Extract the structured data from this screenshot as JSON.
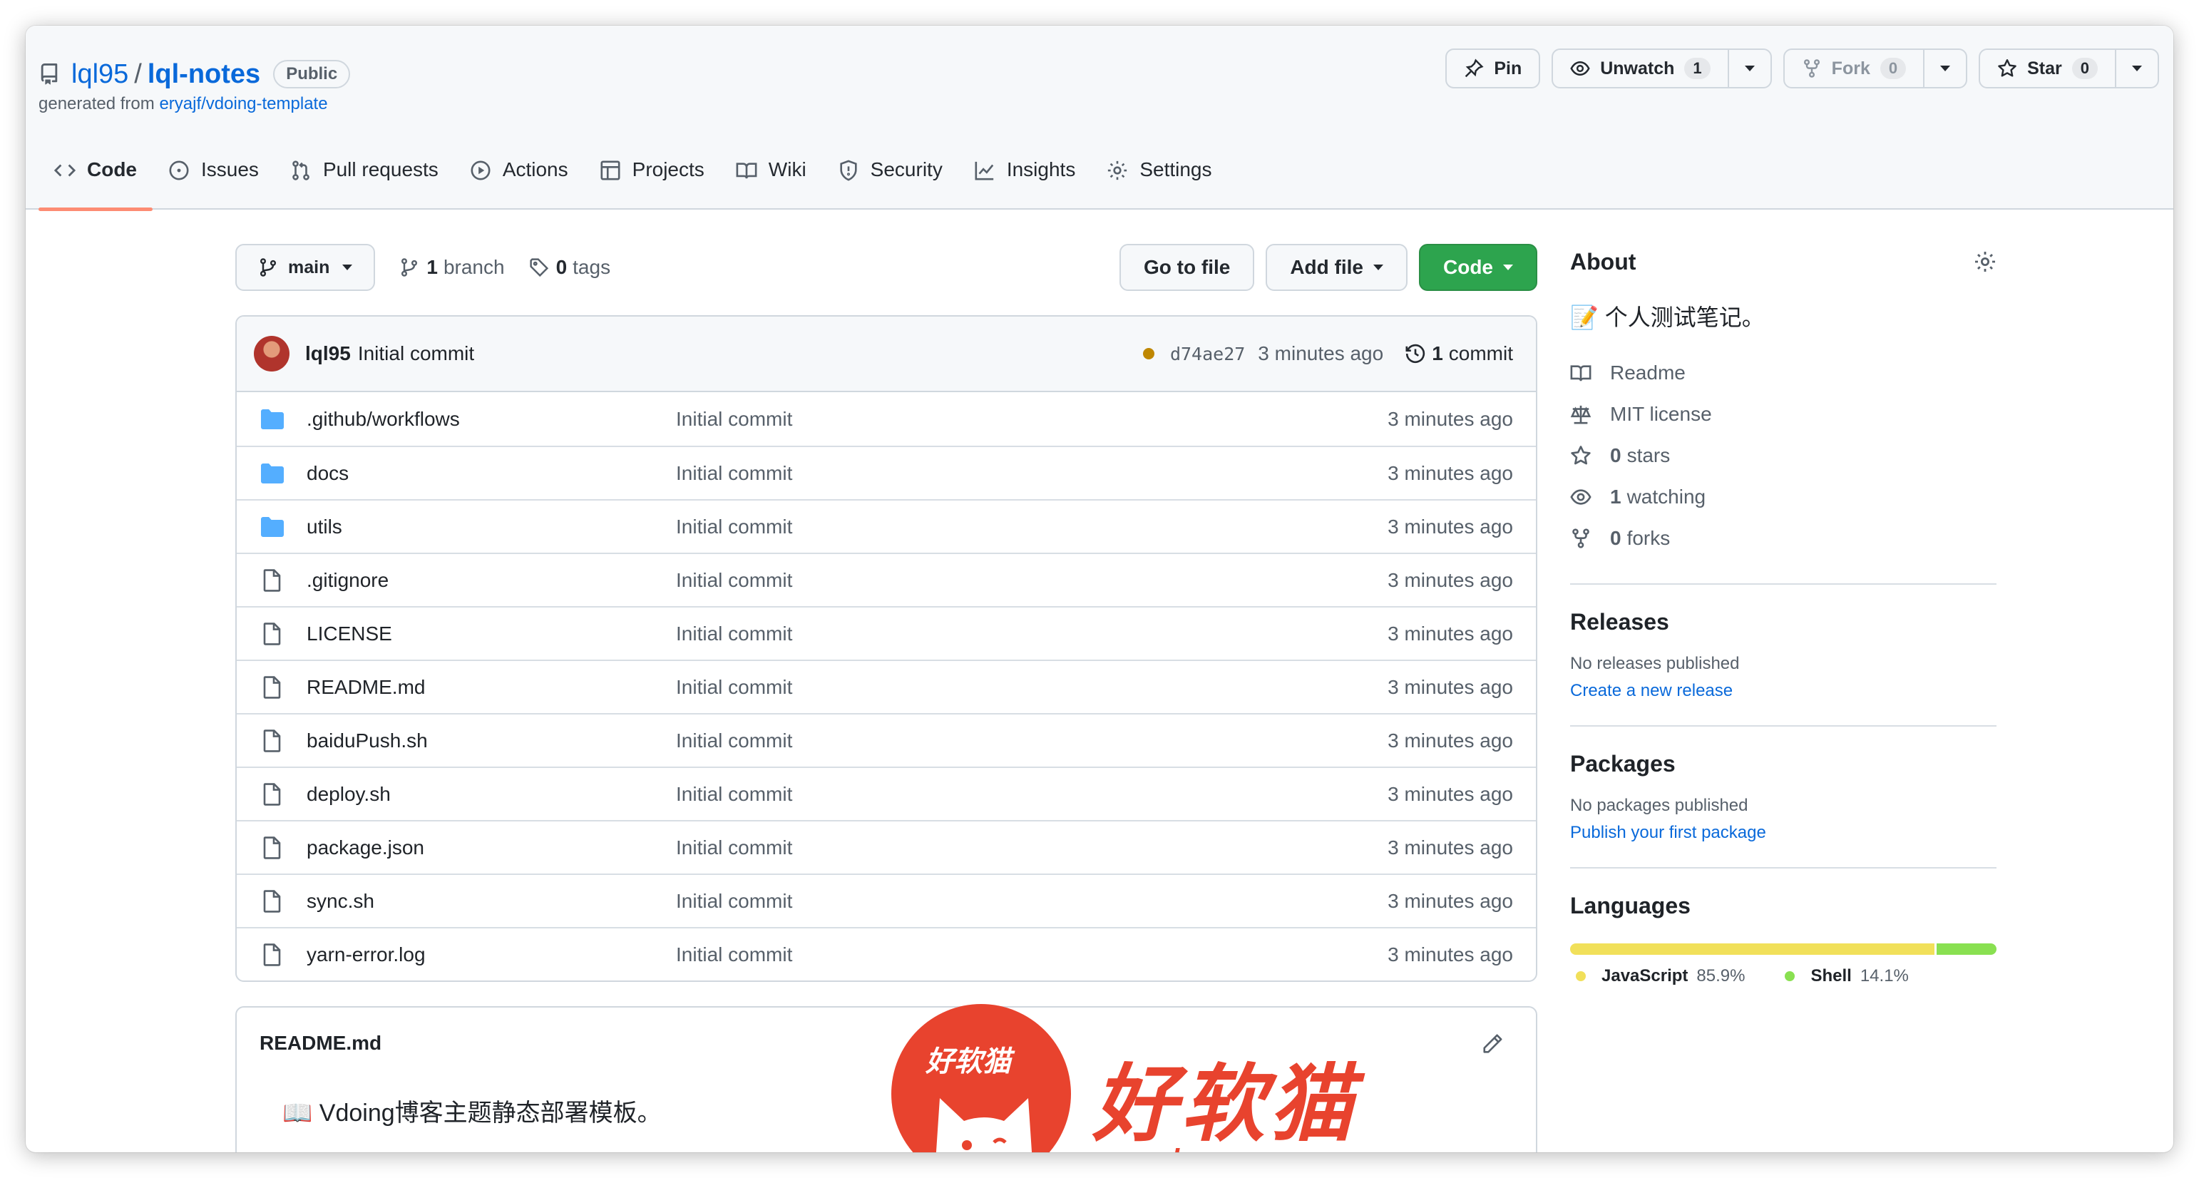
{
  "repo": {
    "owner": "lql95",
    "name": "lql-notes",
    "visibility": "Public",
    "generated_prefix": "generated from ",
    "generated_from": "eryajf/vdoing-template"
  },
  "actions": {
    "pin": "Pin",
    "unwatch": "Unwatch",
    "unwatch_count": "1",
    "fork": "Fork",
    "fork_count": "0",
    "star": "Star",
    "star_count": "0"
  },
  "tabs": [
    {
      "label": "Code",
      "icon": "code-icon",
      "active": true
    },
    {
      "label": "Issues",
      "icon": "issue-icon"
    },
    {
      "label": "Pull requests",
      "icon": "pull-request-icon"
    },
    {
      "label": "Actions",
      "icon": "play-icon"
    },
    {
      "label": "Projects",
      "icon": "table-icon"
    },
    {
      "label": "Wiki",
      "icon": "book-icon"
    },
    {
      "label": "Security",
      "icon": "shield-icon"
    },
    {
      "label": "Insights",
      "icon": "graph-icon"
    },
    {
      "label": "Settings",
      "icon": "gear-icon"
    }
  ],
  "toolbar": {
    "branch": "main",
    "branch_count": "1",
    "branch_label": "branch",
    "tag_count": "0",
    "tag_label": "tags",
    "go_to_file": "Go to file",
    "add_file": "Add file",
    "code": "Code"
  },
  "commit": {
    "author": "lql95",
    "message": "Initial commit",
    "sha": "d74ae27",
    "time": "3 minutes ago",
    "count": "1",
    "count_label": "commit"
  },
  "files": [
    {
      "name": ".github/workflows",
      "type": "dir",
      "message": "Initial commit",
      "time": "3 minutes ago"
    },
    {
      "name": "docs",
      "type": "dir",
      "message": "Initial commit",
      "time": "3 minutes ago"
    },
    {
      "name": "utils",
      "type": "dir",
      "message": "Initial commit",
      "time": "3 minutes ago"
    },
    {
      "name": ".gitignore",
      "type": "file",
      "message": "Initial commit",
      "time": "3 minutes ago"
    },
    {
      "name": "LICENSE",
      "type": "file",
      "message": "Initial commit",
      "time": "3 minutes ago"
    },
    {
      "name": "README.md",
      "type": "file",
      "message": "Initial commit",
      "time": "3 minutes ago"
    },
    {
      "name": "baiduPush.sh",
      "type": "file",
      "message": "Initial commit",
      "time": "3 minutes ago"
    },
    {
      "name": "deploy.sh",
      "type": "file",
      "message": "Initial commit",
      "time": "3 minutes ago"
    },
    {
      "name": "package.json",
      "type": "file",
      "message": "Initial commit",
      "time": "3 minutes ago"
    },
    {
      "name": "sync.sh",
      "type": "file",
      "message": "Initial commit",
      "time": "3 minutes ago"
    },
    {
      "name": "yarn-error.log",
      "type": "file",
      "message": "Initial commit",
      "time": "3 minutes ago"
    }
  ],
  "readme": {
    "filename": "README.md",
    "content": "📖 Vdoing博客主题静态部署模板。"
  },
  "about": {
    "title": "About",
    "description": "📝 个人测试笔记。",
    "readme": "Readme",
    "license": "MIT license",
    "stars_count": "0",
    "stars_label": "stars",
    "watching_count": "1",
    "watching_label": "watching",
    "forks_count": "0",
    "forks_label": "forks"
  },
  "releases": {
    "title": "Releases",
    "empty": "No releases published",
    "link": "Create a new release"
  },
  "packages": {
    "title": "Packages",
    "empty": "No packages published",
    "link": "Publish your first package"
  },
  "languages": {
    "title": "Languages",
    "items": [
      {
        "name": "JavaScript",
        "percent": "85.9%",
        "value": 85.9,
        "color": "#f1e05a"
      },
      {
        "name": "Shell",
        "percent": "14.1%",
        "value": 14.1,
        "color": "#89e051"
      }
    ]
  },
  "watermark": {
    "badge_text": "好软猫",
    "title": "好软猫",
    "url": "www.haoruanmao.com"
  }
}
